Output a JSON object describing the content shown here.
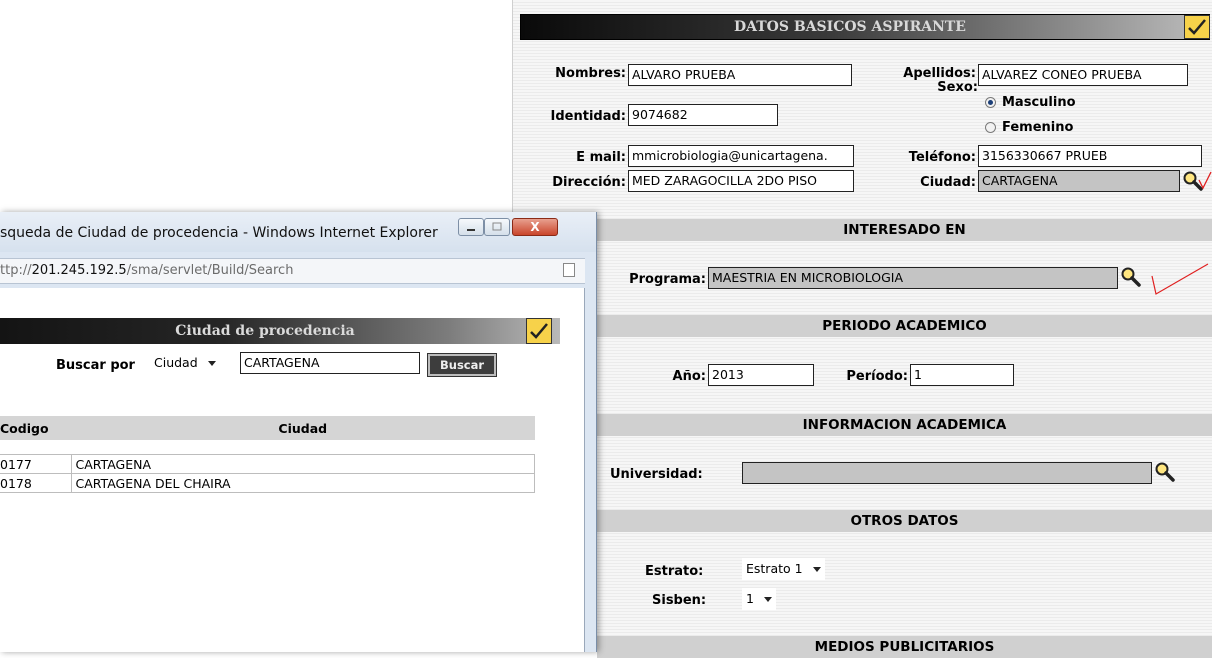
{
  "main": {
    "header_title": "DATOS BASICOS ASPIRANTE",
    "fields": {
      "nombres_label": "Nombres:",
      "nombres_value": "ALVARO      PRUEBA",
      "apellidos_label": "Apellidos:",
      "apellidos_value": "ALVAREZ    CONEO PRUEBA",
      "identidad_label": "Identidad:",
      "identidad_value": "9074682",
      "sexo_label": "Sexo:",
      "sexo_masculino": "Masculino",
      "sexo_femenino": "Femenino",
      "email_label": "E mail:",
      "email_value": "mmicrobiologia@unicartagena.",
      "telefono_label": "Teléfono:",
      "telefono_value": "3156330667     PRUEB",
      "direccion_label": "Dirección:",
      "direccion_value": "MED ZARAGOCILLA 2DO PISO",
      "ciudad_label": "Ciudad:",
      "ciudad_value": "CARTAGENA"
    },
    "interesado": {
      "title": "INTERESADO EN",
      "programa_label": "Programa:",
      "programa_value": "MAESTRIA EN MICROBIOLOGIA"
    },
    "periodo": {
      "title": "PERIODO ACADEMICO",
      "ano_label": "Año:",
      "ano_value": "2013",
      "periodo_label": "Período:",
      "periodo_value": "1"
    },
    "academica": {
      "title": "INFORMACION ACADEMICA",
      "universidad_label": "Universidad:",
      "universidad_value": ""
    },
    "otros": {
      "title": "OTROS DATOS",
      "estrato_label": "Estrato:",
      "estrato_value": "Estrato 1",
      "sisben_label": "Sisben:",
      "sisben_value": "1"
    },
    "medios": {
      "title": "MEDIOS PUBLICITARIOS"
    }
  },
  "popup": {
    "window_title": "squeda de Ciudad de procedencia - Windows Internet Explorer",
    "url_prefix": "ttp://",
    "url_host": "201.245.192.5",
    "url_path": "/sma/servlet/Build/Search",
    "close_label": "X",
    "header_title": "Ciudad de procedencia",
    "buscar_por_label": "Buscar por",
    "buscar_por_value": "Ciudad",
    "search_value": "CARTAGENA",
    "buscar_button": "Buscar",
    "columns": [
      "Codigo",
      "Ciudad"
    ],
    "rows": [
      {
        "codigo": "0177",
        "ciudad": "CARTAGENA"
      },
      {
        "codigo": "0178",
        "ciudad": "CARTAGENA DEL CHAIRA"
      }
    ]
  },
  "colors": {
    "accent_check": "#f7d24a",
    "section_bar": "#d0d0d0",
    "annotation": "#e02020"
  }
}
